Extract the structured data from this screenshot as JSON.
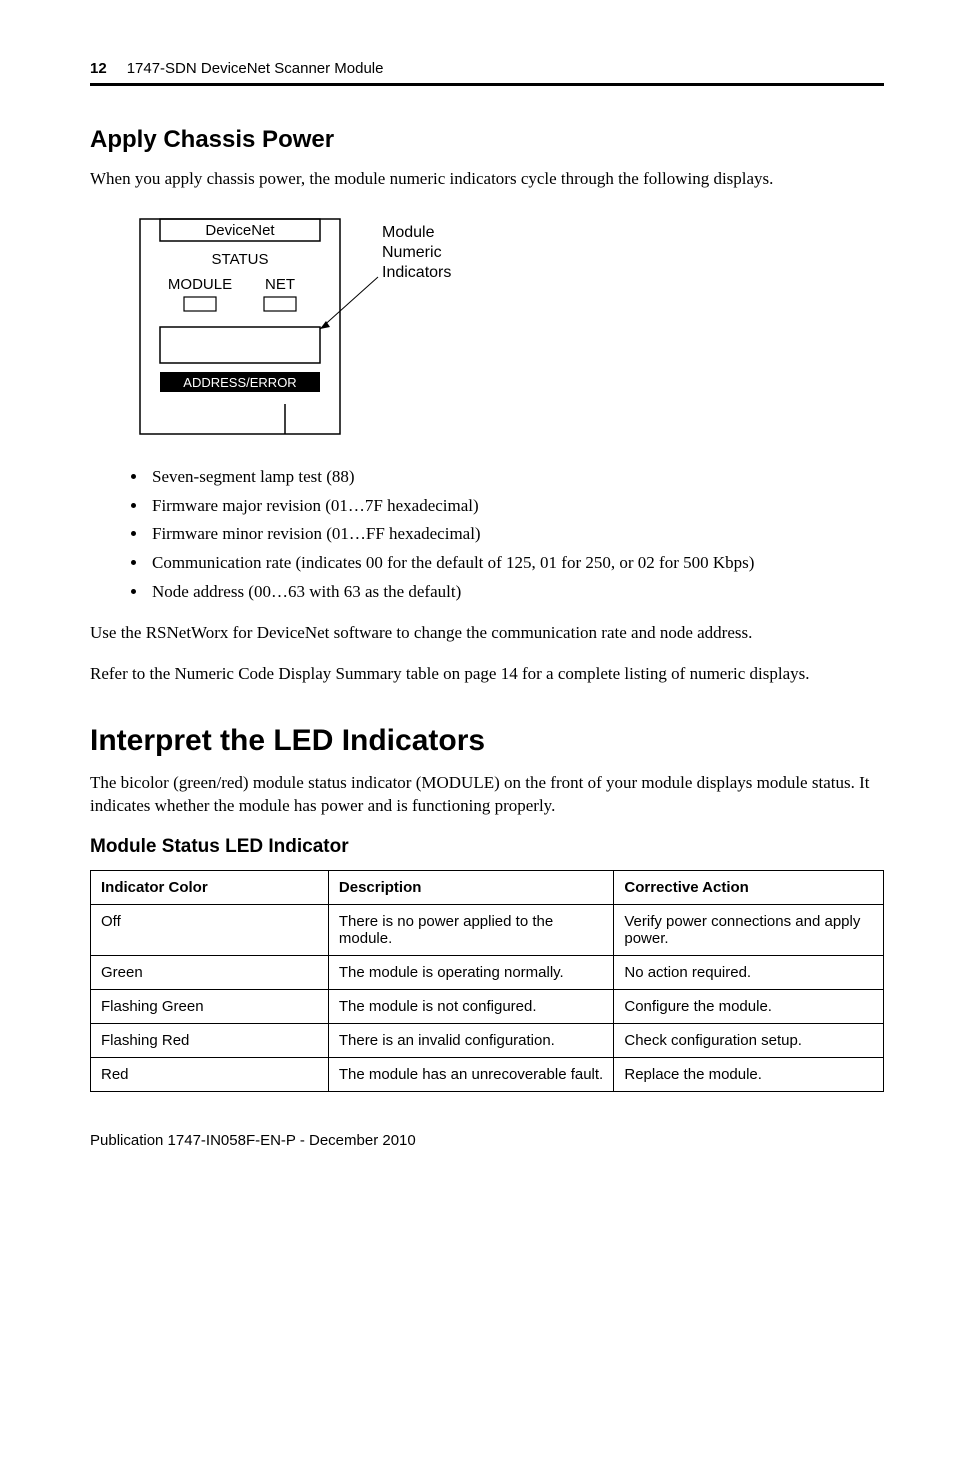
{
  "header": {
    "page_number": "12",
    "doc_title": "1747-SDN DeviceNet Scanner Module"
  },
  "section1": {
    "heading": "Apply Chassis Power",
    "intro": "When you apply chassis power, the module numeric indicators cycle through the following displays."
  },
  "diagram": {
    "top_label": "DeviceNet",
    "status_label": "STATUS",
    "module_label": "MODULE",
    "net_label": "NET",
    "addr_label": "ADDRESS/ERROR",
    "callout_l1": "Module",
    "callout_l2": "Numeric",
    "callout_l3": "Indicators"
  },
  "bullets": [
    "Seven-segment lamp test (88)",
    "Firmware major revision (01…7F hexadecimal)",
    "Firmware minor revision (01…FF hexadecimal)",
    "Communication rate (indicates 00 for the default of 125, 01 for 250, or 02 for 500 Kbps)",
    "Node address (00…63 with 63 as the default)"
  ],
  "para_after_bullets_1": "Use the RSNetWorx for DeviceNet software to change the communication rate and node address.",
  "para_after_bullets_2": "Refer to the Numeric Code Display Summary table on page 14 for a complete listing of numeric displays.",
  "section2": {
    "heading": "Interpret the LED Indicators",
    "intro": "The bicolor (green/red) module status indicator (MODULE) on the front of your module displays module status. It indicates whether the module has power and is functioning properly.",
    "table_heading": "Module Status LED Indicator",
    "columns": [
      "Indicator Color",
      "Description",
      "Corrective Action"
    ],
    "rows": [
      {
        "color": "Off",
        "desc": "There is no power applied to the module.",
        "action": "Verify power connections and apply power."
      },
      {
        "color": "Green",
        "desc": "The module is operating normally.",
        "action": "No action required."
      },
      {
        "color": "Flashing Green",
        "desc": "The module is not configured.",
        "action": "Configure the module."
      },
      {
        "color": "Flashing Red",
        "desc": "There is an invalid configuration.",
        "action": "Check configuration setup."
      },
      {
        "color": "Red",
        "desc": "The module has an unrecoverable fault.",
        "action": "Replace the module."
      }
    ]
  },
  "footer": {
    "pub": "Publication 1747-IN058F-EN-P - December 2010"
  }
}
